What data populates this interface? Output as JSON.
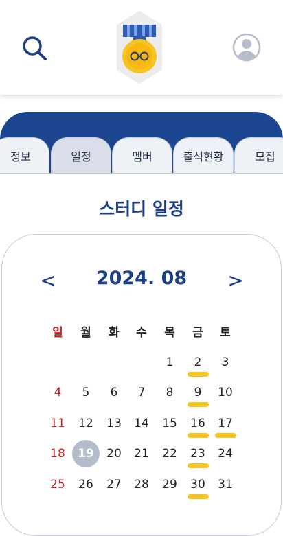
{
  "header": {
    "search_icon": "search-icon",
    "logo_icon": "medal-icon",
    "profile_icon": "user-circle-icon"
  },
  "tabs": [
    "정보",
    "일정",
    "멤버",
    "출석현황",
    "모집"
  ],
  "active_tab": 1,
  "title": "스터디 일정",
  "calendar": {
    "prev_label": "<",
    "next_label": ">",
    "month_label": "2024. 08",
    "weekdays": [
      "일",
      "월",
      "화",
      "수",
      "목",
      "금",
      "토"
    ],
    "first_weekday_index": 4,
    "days_in_month": 31,
    "today": 19,
    "scheduled_days": [
      2,
      9,
      16,
      17,
      23,
      30
    ]
  },
  "colors": {
    "primary": "#1c3f86",
    "band": "#1c4790",
    "sunday": "#cc1f1f",
    "schedule_marker": "#f6c521",
    "today_circle": "#b3bccb"
  }
}
